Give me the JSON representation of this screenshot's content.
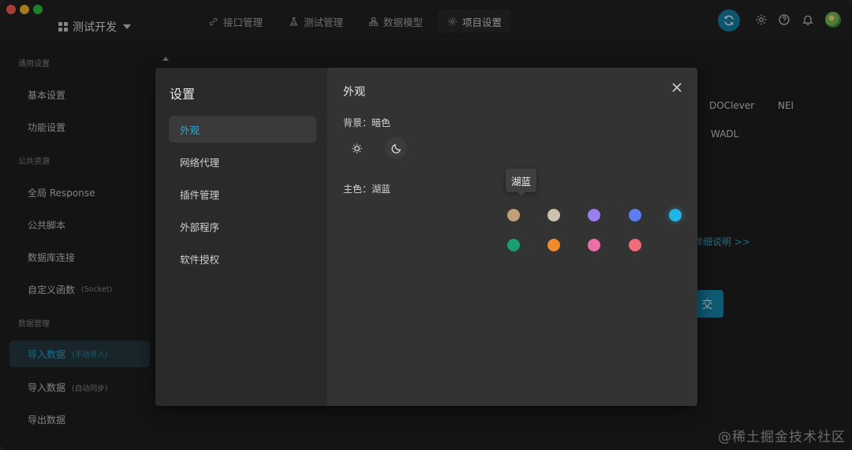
{
  "project": {
    "name": "测试开发"
  },
  "nav_tabs": [
    {
      "label": "接口管理",
      "icon": "link-icon"
    },
    {
      "label": "测试管理",
      "icon": "flask-icon"
    },
    {
      "label": "数据模型",
      "icon": "model-icon"
    },
    {
      "label": "项目设置",
      "icon": "gear-icon",
      "active": true
    }
  ],
  "sidebar": {
    "groups": [
      "通用设置",
      "公共资源",
      "数据管理"
    ],
    "items": [
      {
        "label": "基本设置"
      },
      {
        "label": "功能设置"
      },
      {
        "label": "全局 Response"
      },
      {
        "label": "公共脚本"
      },
      {
        "label": "数据库连接"
      },
      {
        "label": "自定义函数",
        "hint": "(Socket)"
      },
      {
        "label": "导入数据",
        "hint": "(手动导入)",
        "selected": true
      },
      {
        "label": "导入数据",
        "hint": "(自动同步)"
      },
      {
        "label": "导出数据"
      }
    ]
  },
  "background": {
    "formats": [
      "DOClever",
      "NEI",
      "WADL"
    ],
    "help_link": "详细说明 >>",
    "submit_label": "交"
  },
  "modal": {
    "title": "设置",
    "nav": [
      {
        "label": "外观",
        "active": true
      },
      {
        "label": "网络代理"
      },
      {
        "label": "插件管理"
      },
      {
        "label": "外部程序"
      },
      {
        "label": "软件授权"
      }
    ],
    "section_title": "外观",
    "background_label": "背景：暗色",
    "theme_options": [
      {
        "icon": "sun-icon",
        "name": "light"
      },
      {
        "icon": "moon-icon",
        "name": "dark",
        "selected": true
      }
    ],
    "color_label": "主色：湖蓝",
    "colors": [
      {
        "hex": "#c0a07a"
      },
      {
        "hex": "#cdc3ad"
      },
      {
        "hex": "#9c7ef0"
      },
      {
        "hex": "#5c7ef0"
      },
      {
        "hex": "#1fb5e6",
        "selected": true,
        "tooltip": "湖蓝"
      },
      {
        "hex": "#1a9d73"
      },
      {
        "hex": "#f08a2c"
      },
      {
        "hex": "#ea6fa6"
      },
      {
        "hex": "#f06a7a"
      }
    ]
  },
  "watermark": "@稀土掘金技术社区"
}
